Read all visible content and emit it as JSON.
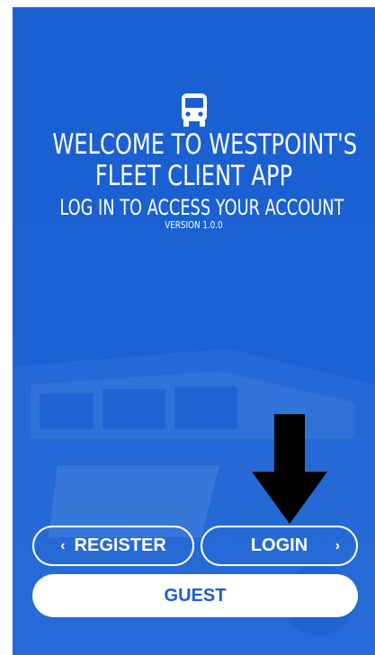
{
  "welcome": {
    "title_line1": "WELCOME TO WESTPOINT'S",
    "title_line2": "FLEET CLIENT APP",
    "subtitle": "LOG IN TO ACCESS YOUR ACCOUNT",
    "version": "VERSION 1.0.0",
    "icon": "bus-icon"
  },
  "annotation": {
    "icon": "arrow-down-icon",
    "color": "#000000"
  },
  "buttons": {
    "register_label": "REGISTER",
    "register_icon": "chevron-left-icon",
    "login_label": "LOGIN",
    "login_icon": "chevron-right-icon",
    "guest_label": "GUEST"
  },
  "colors": {
    "background": "#1a5fd0",
    "primary_text": "#ffffff",
    "guest_text": "#1a5fd0"
  }
}
